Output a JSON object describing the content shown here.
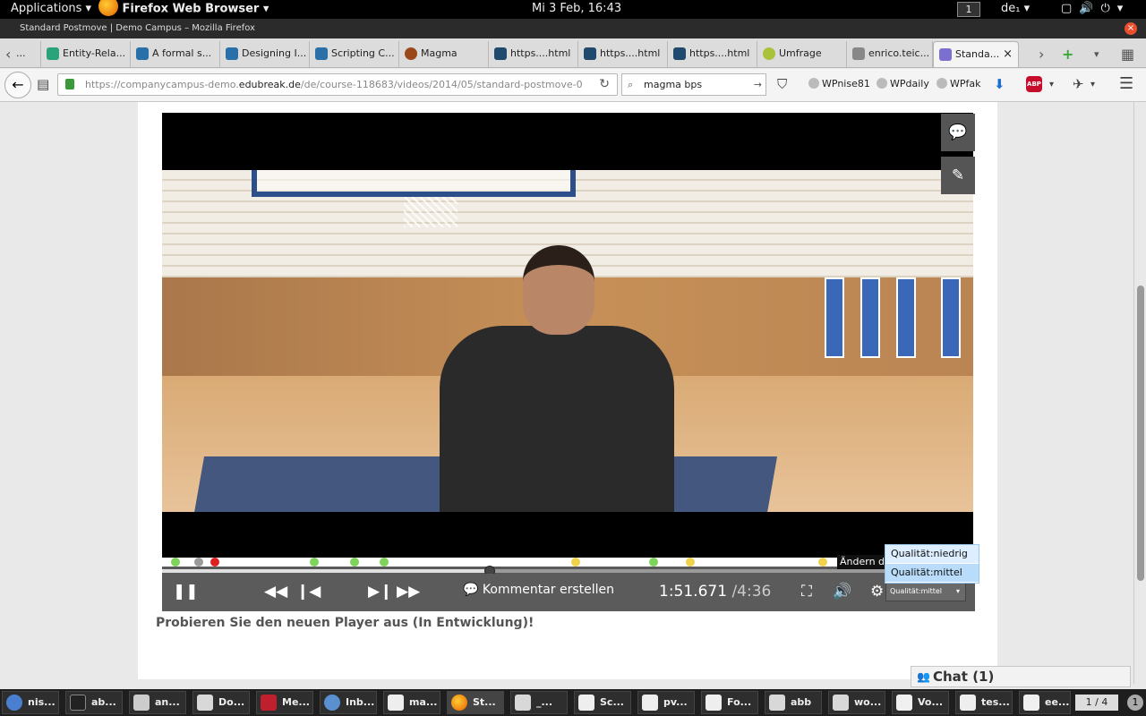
{
  "gnome": {
    "applications": "Applications ▾",
    "firefox": "Firefox Web Browser ▾",
    "clock": "Mi  3 Feb, 16:43",
    "workspace": "1",
    "keyboard": "de₁ ▾",
    "tray": "▢🔊⏻▾"
  },
  "window": {
    "title": "Standard Postmove | Demo Campus – Mozilla Firefox",
    "close": "×"
  },
  "tabs": [
    {
      "label": "..."
    },
    {
      "label": "Entity-Rela..."
    },
    {
      "label": "A formal s..."
    },
    {
      "label": "Designing I..."
    },
    {
      "label": "Scripting C..."
    },
    {
      "label": "Magma"
    },
    {
      "label": "https....html"
    },
    {
      "label": "https....html"
    },
    {
      "label": "https....html"
    },
    {
      "label": "Umfrage"
    },
    {
      "label": "enrico.teic..."
    },
    {
      "label": "Standa..."
    }
  ],
  "nav": {
    "url_prefix": "https://companycampus-demo.",
    "url_domain": "edubreak.de",
    "url_path": "/de/course-118683/videos/2014/05/standard-postmove-0",
    "search": "magma bps",
    "bookmarks": [
      "WPnise81",
      "WPdaily",
      "WPfak"
    ],
    "abp": "ABP"
  },
  "player": {
    "time_current": "1:51.671",
    "time_duration": "/4:36",
    "comment_label": "Kommentar erstellen",
    "quality_selected": "Qualität:mittel",
    "tooltip": "Ändern de",
    "quality_options": [
      "Qualität:niedrig",
      "Qualität:mittel"
    ],
    "progress_fraction": 0.404,
    "marker_colors": {
      "green": "#7ed35a",
      "gray": "#9a9a9a",
      "red": "#e02020",
      "yellow": "#f0d34a"
    }
  },
  "page": {
    "try_new_player": "Probieren Sie den neuen Player aus (In Entwicklung)!"
  },
  "chat": {
    "label": "Chat (1)"
  },
  "taskbar": [
    {
      "label": "nis..."
    },
    {
      "label": "ab..."
    },
    {
      "label": "an..."
    },
    {
      "label": "Do..."
    },
    {
      "label": "Me..."
    },
    {
      "label": "Inb..."
    },
    {
      "label": "ma..."
    },
    {
      "label": "St..."
    },
    {
      "label": "_..."
    },
    {
      "label": "Sc..."
    },
    {
      "label": "pv..."
    },
    {
      "label": "Fo..."
    },
    {
      "label": "abb"
    },
    {
      "label": "wo..."
    },
    {
      "label": "Vo..."
    },
    {
      "label": "tes..."
    },
    {
      "label": "ee..."
    }
  ],
  "pager": "1 / 4",
  "notification": "1"
}
